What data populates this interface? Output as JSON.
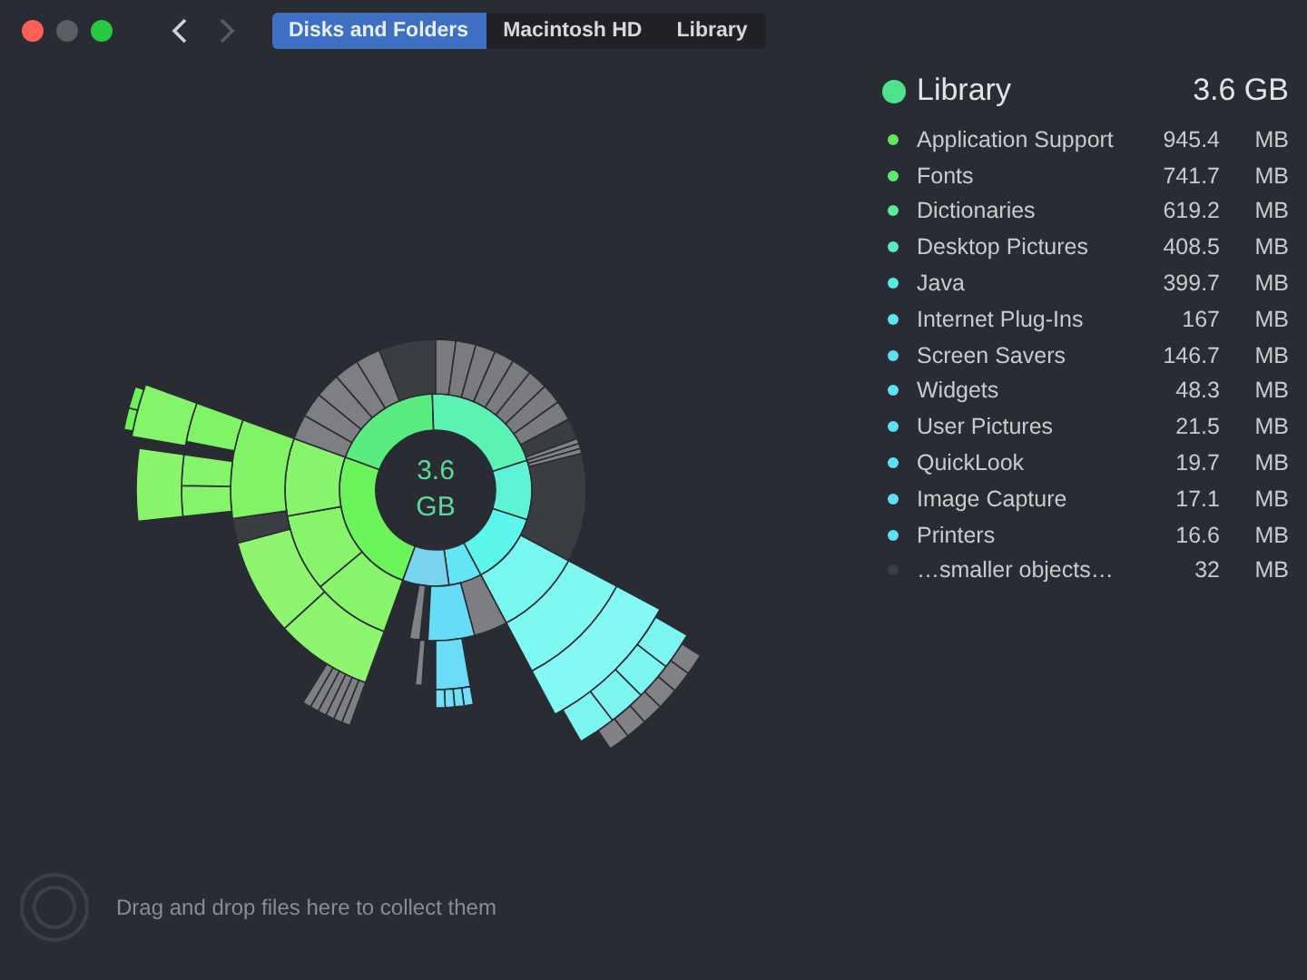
{
  "window": {
    "controls": [
      {
        "kind": "close"
      },
      {
        "kind": "minimize"
      },
      {
        "kind": "zoom"
      }
    ]
  },
  "navigation": [
    {
      "kind": "back",
      "disabled": false
    },
    {
      "kind": "forward",
      "disabled": true
    }
  ],
  "breadcrumbs": [
    {
      "label": "Disks and Folders",
      "selected": true
    },
    {
      "label": "Macintosh HD",
      "selected": false
    },
    {
      "label": "Library",
      "selected": false
    }
  ],
  "chart": {
    "center_label": "3.6 GB"
  },
  "summary": {
    "name": "Library",
    "size": "3.6 GB",
    "color": "#4ee38a"
  },
  "items": [
    {
      "name": "Application Support",
      "size": "945.4",
      "unit": "MB",
      "color": "#5fe85a"
    },
    {
      "name": "Fonts",
      "size": "741.7",
      "unit": "MB",
      "color": "#5ee870"
    },
    {
      "name": "Dictionaries",
      "size": "619.2",
      "unit": "MB",
      "color": "#5ee89c"
    },
    {
      "name": "Desktop Pictures",
      "size": "408.5",
      "unit": "MB",
      "color": "#5ee8c8"
    },
    {
      "name": "Java",
      "size": "399.7",
      "unit": "MB",
      "color": "#5ee6e0"
    },
    {
      "name": "Internet Plug-Ins",
      "size": "167",
      "unit": "MB",
      "color": "#5ee2f0"
    },
    {
      "name": "Screen Savers",
      "size": "146.7",
      "unit": "MB",
      "color": "#5ee0f2"
    },
    {
      "name": "Widgets",
      "size": "48.3",
      "unit": "MB",
      "color": "#5edff4"
    },
    {
      "name": "User Pictures",
      "size": "21.5",
      "unit": "MB",
      "color": "#5edff4"
    },
    {
      "name": "QuickLook",
      "size": "19.7",
      "unit": "MB",
      "color": "#5edff4"
    },
    {
      "name": "Image Capture",
      "size": "17.1",
      "unit": "MB",
      "color": "#5edff4"
    },
    {
      "name": "Printers",
      "size": "16.6",
      "unit": "MB",
      "color": "#5edff4"
    },
    {
      "name": "…smaller objects…",
      "size": "32",
      "unit": "MB",
      "color": "#3b3e44"
    }
  ],
  "drop_hint": "Drag and drop files here to collect them"
}
